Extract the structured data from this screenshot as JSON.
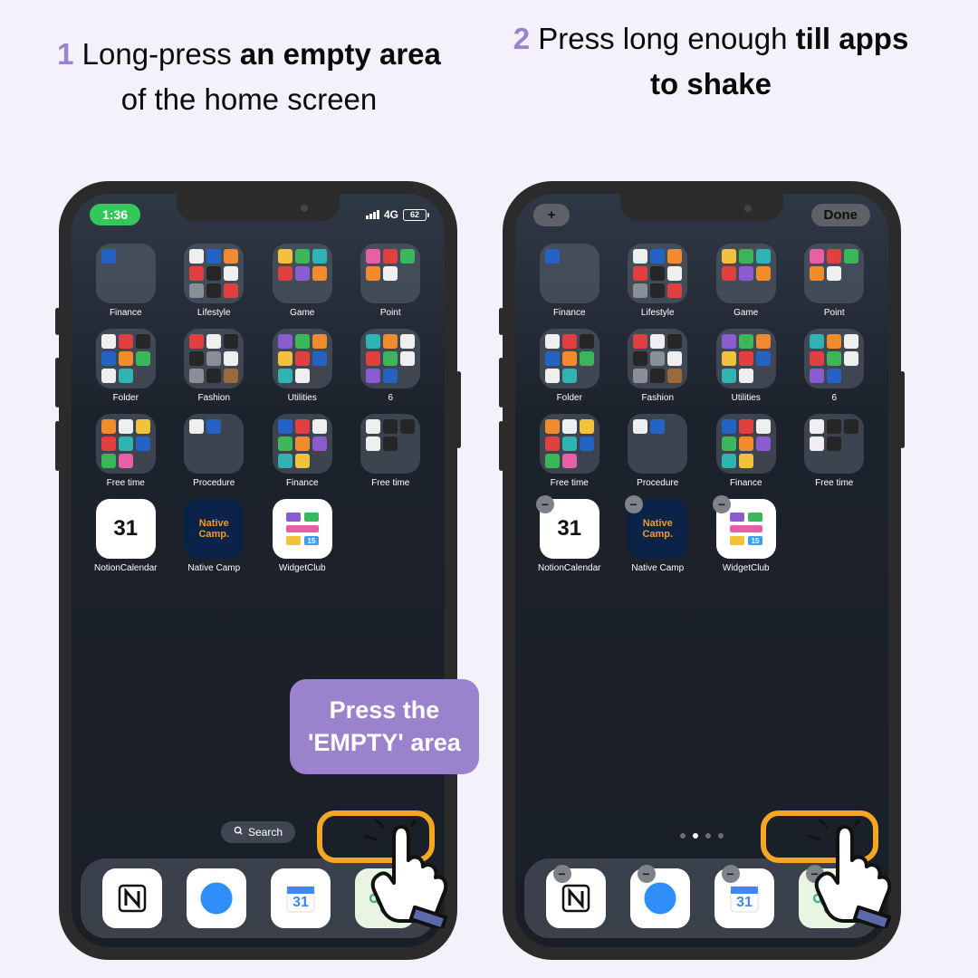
{
  "captions": {
    "step1_num": "1",
    "step1_a": "Long-press ",
    "step1_b": "an empty area",
    "step1_c": " of the home screen",
    "step2_num": "2",
    "step2_a": "Press long enough ",
    "step2_b": "till apps to shake"
  },
  "callout": {
    "line1": "Press the",
    "line2": "'EMPTY' area"
  },
  "phone1": {
    "time": "1:36",
    "network": "4G",
    "battery": "62",
    "search": "Search"
  },
  "phone2": {
    "add": "+",
    "done": "Done",
    "remove": "−"
  },
  "folders": [
    {
      "label": "Finance"
    },
    {
      "label": "Lifestyle"
    },
    {
      "label": "Game"
    },
    {
      "label": "Point"
    },
    {
      "label": "Folder"
    },
    {
      "label": "Fashion"
    },
    {
      "label": "Utilities"
    },
    {
      "label": "6"
    },
    {
      "label": "Free time"
    },
    {
      "label": "Procedure"
    },
    {
      "label": "Finance"
    },
    {
      "label": "Free time"
    }
  ],
  "apps": [
    {
      "label": "NotionCalendar",
      "text": "31",
      "bg": "#ffffff",
      "fg": "#111"
    },
    {
      "label": "Native Camp",
      "text": "Native\nCamp.",
      "bg": "#0b2347",
      "fg": "#f09a2e",
      "small": true
    },
    {
      "label": "WidgetClub",
      "text": "",
      "bg": "#ffffff",
      "fg": "#111",
      "widget": true
    }
  ],
  "dock_apps": [
    {
      "name": "notion",
      "bg": "#ffffff"
    },
    {
      "name": "safari",
      "bg": "#ffffff"
    },
    {
      "name": "calendar",
      "bg": "#ffffff"
    },
    {
      "name": "chatgpt",
      "bg": "#e8f5e3"
    }
  ],
  "folder_minis": [
    [
      "c-blue",
      "",
      "",
      "",
      "",
      "",
      "",
      "",
      ""
    ],
    [
      "c-white",
      "c-blue",
      "c-orange",
      "c-red",
      "c-black",
      "c-white",
      "c-grey",
      "c-black",
      "c-red"
    ],
    [
      "c-yellow",
      "c-green",
      "c-teal",
      "c-red",
      "c-purple",
      "c-orange",
      "",
      "",
      ""
    ],
    [
      "c-pink",
      "c-red",
      "c-green",
      "c-orange",
      "c-white",
      "",
      "",
      "",
      ""
    ],
    [
      "c-white",
      "c-red",
      "c-black",
      "c-blue",
      "c-orange",
      "c-green",
      "c-white",
      "c-teal",
      ""
    ],
    [
      "c-red",
      "c-white",
      "c-black",
      "c-black",
      "c-grey",
      "c-white",
      "c-grey",
      "c-black",
      "c-brown"
    ],
    [
      "c-purple",
      "c-green",
      "c-orange",
      "c-yellow",
      "c-red",
      "c-blue",
      "c-teal",
      "c-white",
      ""
    ],
    [
      "c-teal",
      "c-orange",
      "c-white",
      "c-red",
      "c-green",
      "c-white",
      "c-purple",
      "c-blue",
      ""
    ],
    [
      "c-orange",
      "c-white",
      "c-yellow",
      "c-red",
      "c-teal",
      "c-blue",
      "c-green",
      "c-pink",
      ""
    ],
    [
      "c-white",
      "c-blue",
      "",
      "",
      "",
      "",
      "",
      "",
      ""
    ],
    [
      "c-blue",
      "c-red",
      "c-white",
      "c-green",
      "c-orange",
      "c-purple",
      "c-teal",
      "c-yellow",
      ""
    ],
    [
      "c-white",
      "c-black",
      "c-black",
      "c-white",
      "c-black",
      "",
      "",
      "",
      ""
    ]
  ]
}
